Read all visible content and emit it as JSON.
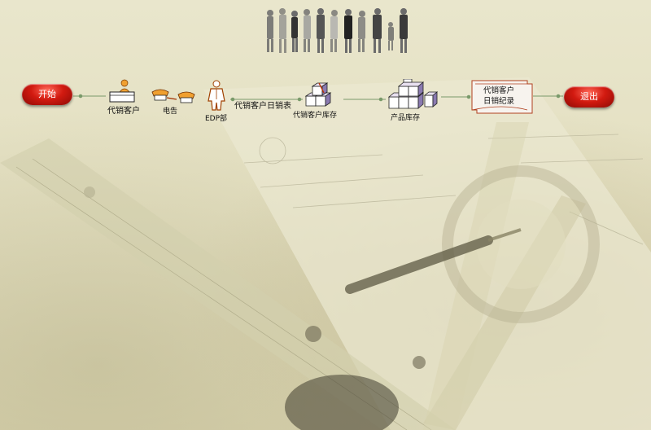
{
  "buttons": {
    "start": "开始",
    "exit": "退出"
  },
  "nodes": {
    "agent_customer": "代销客户",
    "telegram": "电告",
    "edp": "EDP部",
    "daily_report": "代销客户日销表",
    "agent_inventory": "代销客户库存",
    "product_inventory": "产品库存",
    "daily_record_line1": "代销客户",
    "daily_record_line2": "日销纪录"
  },
  "colors": {
    "accent_red": "#d21a10",
    "line_green": "#7a9a6a",
    "background": "#e6e2c6"
  }
}
